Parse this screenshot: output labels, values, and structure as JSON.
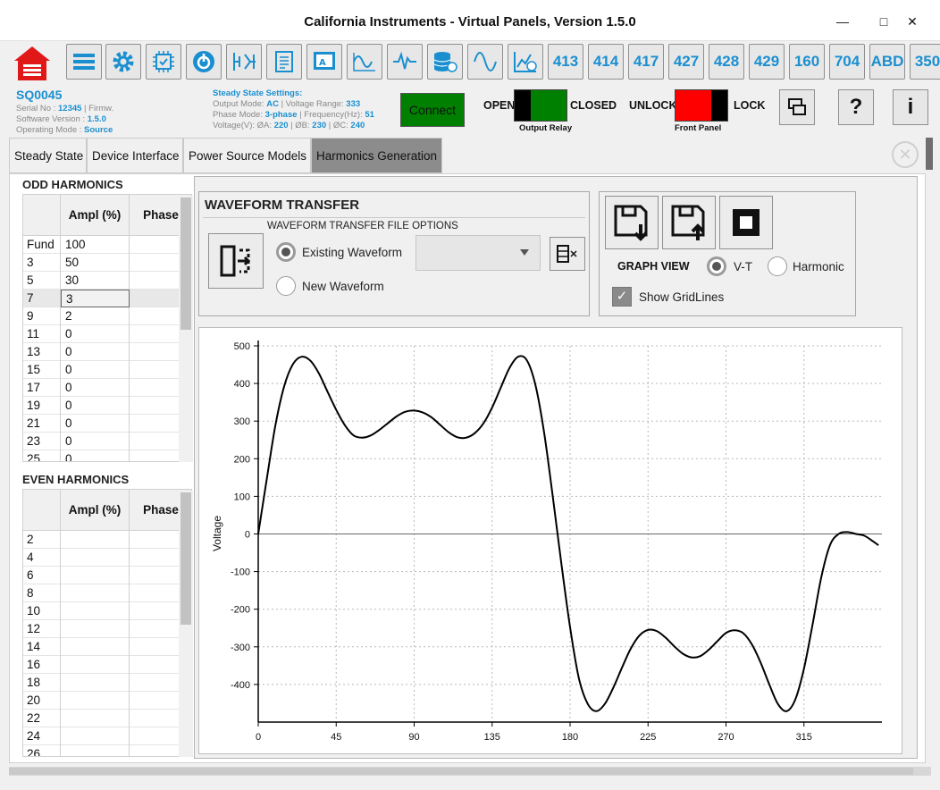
{
  "window": {
    "title": "California Instruments - Virtual Panels, Version 1.5.0"
  },
  "toolbar": {
    "numbered_buttons": [
      "413",
      "414",
      "417",
      "427",
      "428",
      "429",
      "160",
      "704",
      "ABD",
      "350"
    ]
  },
  "device": {
    "id": "SQ0045",
    "serial_label": "Serial No : ",
    "serial_value": "12345",
    "firmware_label": " | Firmw.",
    "software_label": "Software Version : ",
    "software_value": "1.5.0",
    "mode_label": "Operating Mode : ",
    "mode_value": "Source"
  },
  "steady_state": {
    "title": "Steady State Settings:",
    "output_mode_label": "Output Mode: ",
    "output_mode": "AC",
    "voltage_range_label": " | Voltage Range: ",
    "voltage_range": "333",
    "phase_mode_label": "Phase Mode: ",
    "phase_mode": "3-phase",
    "frequency_label": " | Frequency(Hz): ",
    "frequency": "51",
    "voltage_label": "Voltage(V): ØA: ",
    "va": "220",
    "vb_label": " | ØB: ",
    "vb": "230",
    "vc_label": " | ØC: ",
    "vc": "240"
  },
  "controls": {
    "connect_label": "Connect",
    "open_label": "OPEN",
    "closed_label": "CLOSED",
    "output_relay_label": "Output Relay",
    "unlock_label": "UNLOCK",
    "lock_label": "LOCK",
    "front_panel_label": "Front Panel",
    "help_label": "?",
    "info_label": "i"
  },
  "tabs": [
    "Steady State",
    "Device Interface",
    "Power Source Models",
    "Harmonics Generation"
  ],
  "active_tab": "Harmonics Generation",
  "odd_harmonics": {
    "title": "ODD HARMONICS",
    "headers": [
      "",
      "Ampl (%)",
      "Phase"
    ],
    "rows": [
      [
        "Fund",
        "100",
        ""
      ],
      [
        "3",
        "50",
        ""
      ],
      [
        "5",
        "30",
        ""
      ],
      [
        "7",
        "3",
        ""
      ],
      [
        "9",
        "2",
        ""
      ],
      [
        "11",
        "0",
        ""
      ],
      [
        "13",
        "0",
        ""
      ],
      [
        "15",
        "0",
        ""
      ],
      [
        "17",
        "0",
        ""
      ],
      [
        "19",
        "0",
        ""
      ],
      [
        "21",
        "0",
        ""
      ],
      [
        "23",
        "0",
        ""
      ],
      [
        "25",
        "0",
        ""
      ]
    ]
  },
  "even_harmonics": {
    "title": "EVEN HARMONICS",
    "headers": [
      "",
      "Ampl (%)",
      "Phase"
    ],
    "rows": [
      [
        "2",
        "",
        ""
      ],
      [
        "4",
        "",
        ""
      ],
      [
        "6",
        "",
        ""
      ],
      [
        "8",
        "",
        ""
      ],
      [
        "10",
        "",
        ""
      ],
      [
        "12",
        "",
        ""
      ],
      [
        "14",
        "",
        ""
      ],
      [
        "16",
        "",
        ""
      ],
      [
        "18",
        "",
        ""
      ],
      [
        "20",
        "",
        ""
      ],
      [
        "22",
        "",
        ""
      ],
      [
        "24",
        "",
        ""
      ],
      [
        "26",
        "",
        ""
      ]
    ]
  },
  "waveform_transfer": {
    "title": "WAVEFORM TRANSFER",
    "options_label": "WAVEFORM TRANSFER FILE OPTIONS",
    "existing_label": "Existing Waveform",
    "new_label": "New Waveform",
    "selected": "Existing Waveform",
    "combo_value": ""
  },
  "graph_view": {
    "label": "GRAPH VIEW",
    "vt_label": "V-T",
    "harmonic_label": "Harmonic",
    "selected": "V-T",
    "gridlines_label": "Show GridLines",
    "gridlines_checked": true
  },
  "chart_data": {
    "type": "line",
    "ylabel": "Voltage",
    "xlabel": "",
    "xlim": [
      0,
      360
    ],
    "ylim": [
      -500,
      500
    ],
    "x_ticks": [
      0,
      45,
      90,
      135,
      180,
      225,
      270,
      315
    ],
    "y_ticks": [
      500,
      400,
      300,
      200,
      100,
      0,
      -100,
      -200,
      -300,
      -400
    ],
    "grid": true,
    "line_color": "#000000",
    "series": [
      {
        "x": [
          0,
          5,
          10,
          15,
          20,
          25,
          30,
          35,
          40,
          45,
          50,
          55,
          60,
          65,
          70,
          75,
          80,
          85,
          90,
          95,
          100,
          105,
          110,
          115,
          120,
          125,
          130,
          135,
          140,
          145,
          150,
          155,
          160,
          165,
          170,
          175,
          180,
          185,
          190,
          195,
          200,
          205,
          210,
          215,
          220,
          225,
          230,
          235,
          240,
          245,
          250,
          255,
          260,
          265,
          270,
          275,
          280,
          285,
          290,
          295,
          300,
          305,
          310,
          315,
          320,
          325,
          330,
          335,
          340,
          345,
          350,
          355,
          358
        ],
        "y": [
          0,
          148,
          291,
          393,
          451,
          471,
          461,
          427,
          378,
          330,
          289,
          262,
          256,
          262,
          277,
          295,
          313,
          325,
          328,
          323,
          310,
          290,
          270,
          257,
          256,
          268,
          294,
          336,
          389,
          441,
          471,
          462,
          396,
          270,
          100,
          -80,
          -248,
          -382,
          -450,
          -471,
          -452,
          -408,
          -355,
          -305,
          -270,
          -255,
          -258,
          -275,
          -298,
          -318,
          -328,
          -325,
          -308,
          -285,
          -263,
          -256,
          -264,
          -294,
          -342,
          -400,
          -452,
          -471,
          -440,
          -358,
          -240,
          -115,
          -30,
          0,
          5,
          0,
          -5,
          -20,
          -30
        ]
      }
    ]
  }
}
